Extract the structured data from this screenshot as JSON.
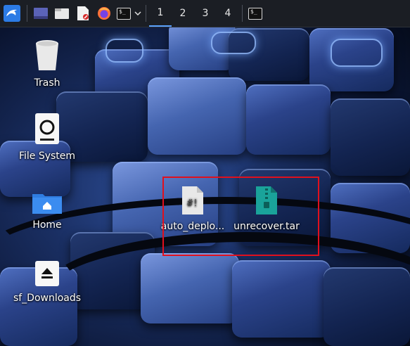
{
  "taskbar": {
    "workspaces": [
      "1",
      "2",
      "3",
      "4"
    ],
    "active_workspace": "1",
    "icons": [
      "kali-menu-icon",
      "show-desktop-icon",
      "file-manager-icon",
      "text-editor-icon",
      "firefox-icon",
      "terminal-icon"
    ]
  },
  "desktop": {
    "icons": [
      {
        "label": "Trash"
      },
      {
        "label": "File System"
      },
      {
        "label": "Home"
      },
      {
        "label": "sf_Downloads"
      },
      {
        "label": "auto_deplo..."
      },
      {
        "label": "unrecover.tar"
      }
    ],
    "script_glyph": "#!"
  },
  "colors": {
    "taskbar_bg": "#1b1e24",
    "accent": "#5aa2ff",
    "selection_border": "#e0101d"
  }
}
